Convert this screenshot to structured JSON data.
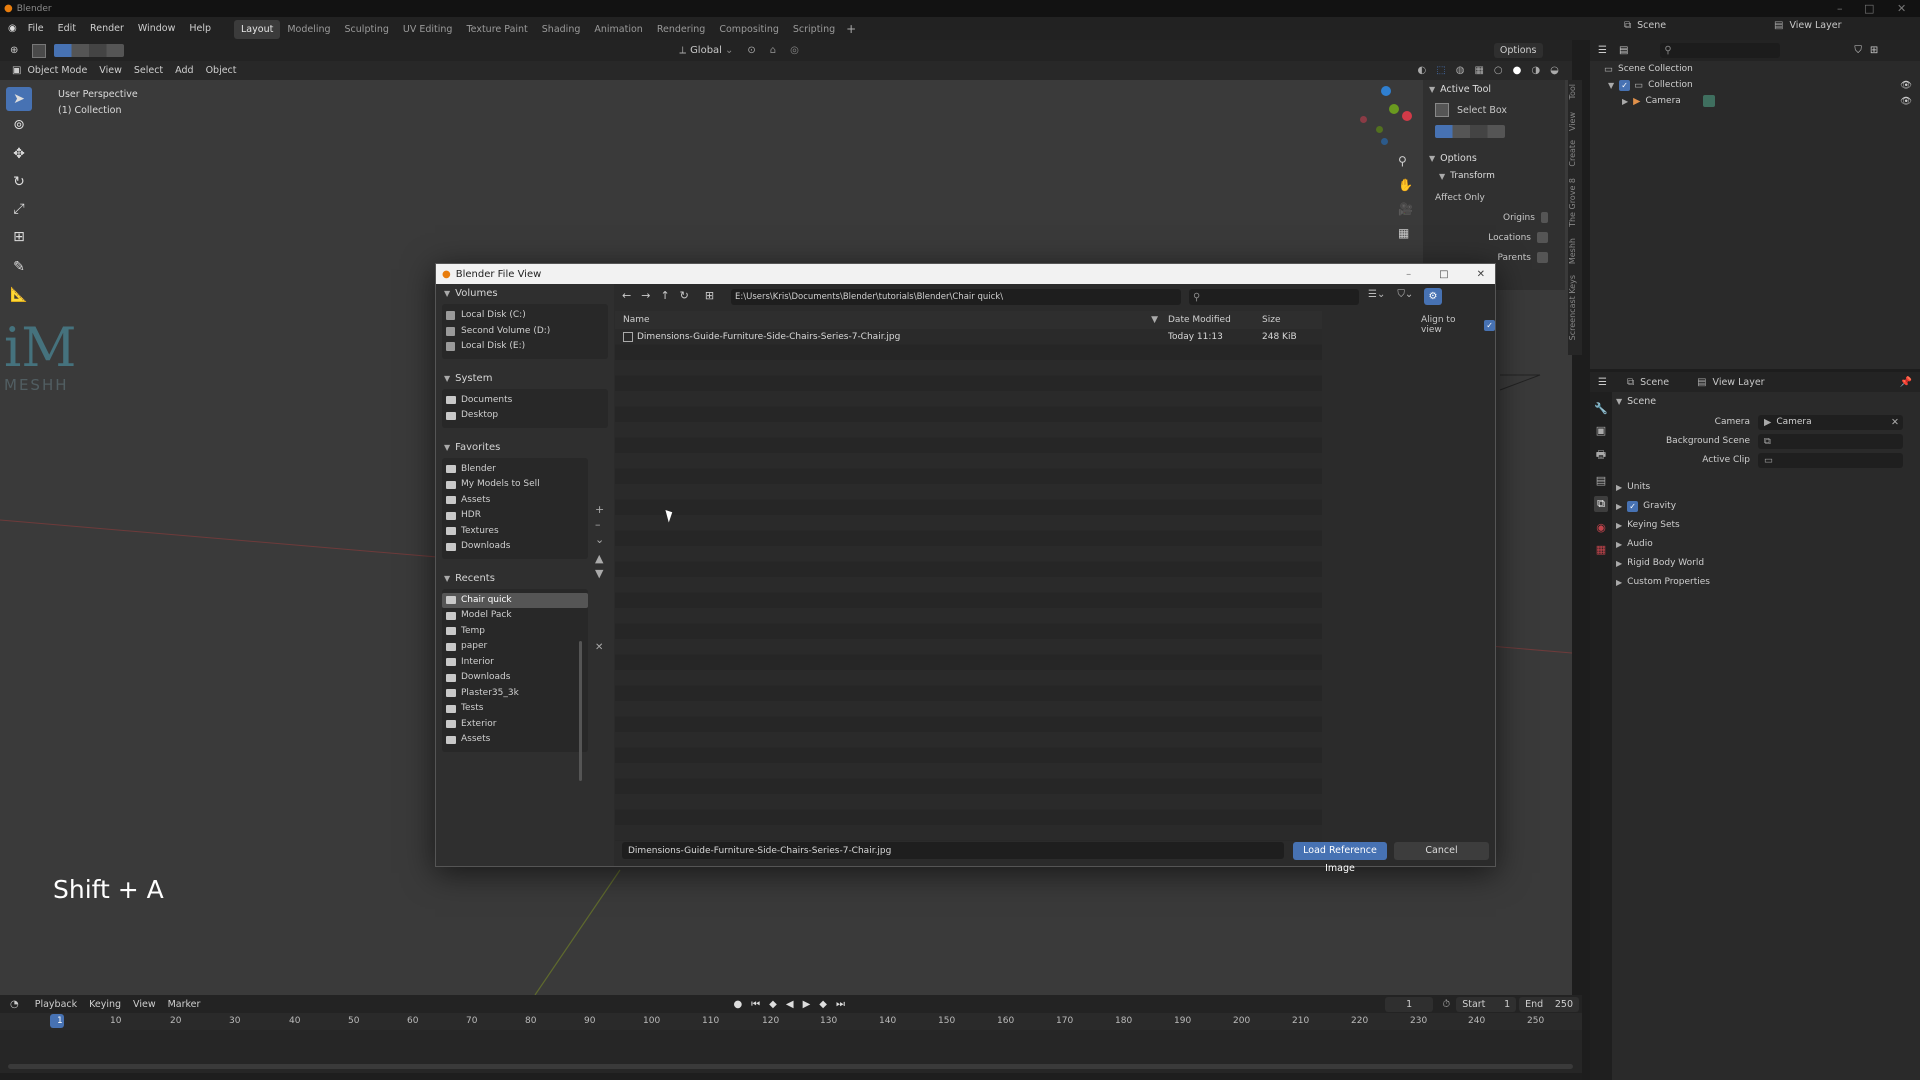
{
  "titlebar": {
    "title": "Blender"
  },
  "menu": [
    "File",
    "Edit",
    "Render",
    "Window",
    "Help"
  ],
  "workspaces": [
    "Layout",
    "Modeling",
    "Sculpting",
    "UV Editing",
    "Texture Paint",
    "Shading",
    "Animation",
    "Rendering",
    "Compositing",
    "Scripting"
  ],
  "workspace_active": "Layout",
  "scene": {
    "name": "Scene",
    "view_layer": "View Layer"
  },
  "header": {
    "transform": "Global",
    "options": "Options"
  },
  "viewport_header": {
    "mode": "Object Mode",
    "items": [
      "View",
      "Select",
      "Add",
      "Object"
    ]
  },
  "viewport": {
    "overlay_line1": "User Perspective",
    "overlay_line2": "(1) Collection",
    "shortcut_text": "Shift + A",
    "logo_text": "iM",
    "logo_sub": "MESHH"
  },
  "npanel": {
    "active_tool": "Active Tool",
    "tool_name": "Select Box",
    "options": "Options",
    "transform": "Transform",
    "affect_only": "Affect Only",
    "origins": "Origins",
    "locations": "Locations",
    "parents": "Parents",
    "tabs": [
      "Tool",
      "View",
      "Create",
      "The Grove 8",
      "Meshh",
      "Screencast Keys"
    ]
  },
  "dialog": {
    "title": "Blender File View",
    "path": "E:\\Users\\Kris\\Documents\\Blender\\tutorials\\Blender\\Chair quick\\",
    "search_placeholder": "",
    "columns": {
      "name": "Name",
      "date": "Date Modified",
      "size": "Size"
    },
    "files": [
      {
        "name": "Dimensions-Guide-Furniture-Side-Chairs-Series-7-Chair.jpg",
        "date": "Today 11:13",
        "size": "248 KiB"
      }
    ],
    "align_to_view": "Align to view",
    "filename": "Dimensions-Guide-Furniture-Side-Chairs-Series-7-Chair.jpg",
    "load_button": "Load Reference Image",
    "cancel_button": "Cancel",
    "volumes_title": "Volumes",
    "volumes": [
      "Local Disk (C:)",
      "Second Volume (D:)",
      "Local Disk (E:)"
    ],
    "system_title": "System",
    "system": [
      "Documents",
      "Desktop"
    ],
    "favorites_title": "Favorites",
    "favorites": [
      "Blender",
      "My Models to Sell",
      "Assets",
      "HDR",
      "Textures",
      "Downloads"
    ],
    "recents_title": "Recents",
    "recents": [
      "Chair quick",
      "Model Pack",
      "Temp",
      "paper",
      "Interior",
      "Downloads",
      "Plaster35_3k",
      "Tests",
      "Exterior",
      "Assets"
    ]
  },
  "timeline": {
    "menus": [
      "Playback",
      "Keying",
      "View",
      "Marker"
    ],
    "current_frame": "1",
    "start_label": "Start",
    "start": "1",
    "end_label": "End",
    "end": "250",
    "ticks": [
      "1",
      "10",
      "20",
      "30",
      "40",
      "50",
      "60",
      "70",
      "80",
      "90",
      "100",
      "110",
      "120",
      "130",
      "140",
      "150",
      "160",
      "170",
      "180",
      "190",
      "200",
      "210",
      "220",
      "230",
      "240",
      "250"
    ]
  },
  "outliner": {
    "scene_collection": "Scene Collection",
    "collection": "Collection",
    "camera": "Camera"
  },
  "properties": {
    "header_scene": "Scene",
    "header_view_layer": "View Layer",
    "section": "Scene",
    "camera_label": "Camera",
    "camera_value": "Camera",
    "background_scene": "Background Scene",
    "active_clip": "Active Clip",
    "panels": [
      "Units",
      "Gravity",
      "Keying Sets",
      "Audio",
      "Rigid Body World",
      "Custom Properties"
    ]
  },
  "colors": {
    "accent": "#4772b3",
    "viewport": "#3a3a3a",
    "panel": "#2b2b2b"
  }
}
